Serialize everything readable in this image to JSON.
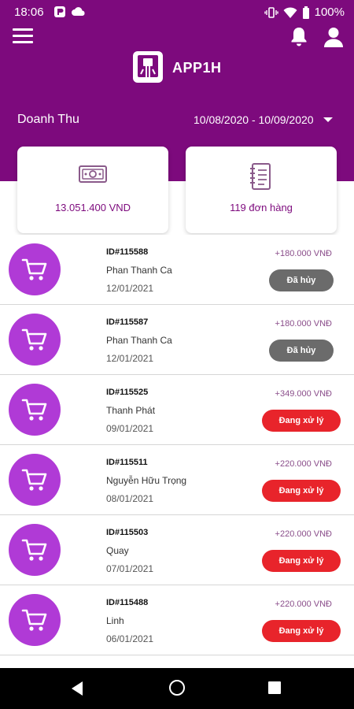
{
  "status_bar": {
    "time": "18:06",
    "battery": "100%",
    "icons": [
      "app-notification-icon",
      "cloud-icon",
      "vibrate-icon",
      "wifi-icon",
      "battery-icon"
    ]
  },
  "header": {
    "app_name": "APP1H",
    "icons": [
      "menu-icon",
      "bell-icon",
      "user-icon",
      "app-logo"
    ],
    "background_color": "#7d0a7d"
  },
  "revenue": {
    "label": "Doanh Thu",
    "date_range": "10/08/2020 - 10/09/2020"
  },
  "stats": {
    "revenue_value": "13.051.400 VND",
    "orders_value": "119 đơn hàng",
    "icons": [
      "money-icon",
      "notebook-icon"
    ]
  },
  "orders": [
    {
      "id": "ID#115588",
      "name": "Phan Thanh Ca",
      "date": "12/01/2021",
      "amount": "+180.000 VNĐ",
      "status": "Đã hủy",
      "status_type": "cancelled"
    },
    {
      "id": "ID#115587",
      "name": "Phan Thanh Ca",
      "date": "12/01/2021",
      "amount": "+180.000 VNĐ",
      "status": "Đã hủy",
      "status_type": "cancelled"
    },
    {
      "id": "ID#115525",
      "name": "Thanh Phát",
      "date": "09/01/2021",
      "amount": "+349.000 VNĐ",
      "status": "Đang xử lý",
      "status_type": "processing"
    },
    {
      "id": "ID#115511",
      "name": "Nguyễn Hữu Trọng",
      "date": "08/01/2021",
      "amount": "+220.000 VNĐ",
      "status": "Đang xử lý",
      "status_type": "processing"
    },
    {
      "id": "ID#115503",
      "name": "Quay",
      "date": "07/01/2021",
      "amount": "+220.000 VNĐ",
      "status": "Đang xử lý",
      "status_type": "processing"
    },
    {
      "id": "ID#115488",
      "name": "Linh",
      "date": "06/01/2021",
      "amount": "+220.000 VNĐ",
      "status": "Đang xử lý",
      "status_type": "processing"
    }
  ],
  "colors": {
    "accent": "#7d0a7d",
    "avatar": "#b03ad6",
    "cancelled": "#6b6b6b",
    "processing": "#e8242b"
  },
  "nav_bar": {
    "icons": [
      "back-icon",
      "home-icon",
      "recent-apps-icon"
    ]
  }
}
